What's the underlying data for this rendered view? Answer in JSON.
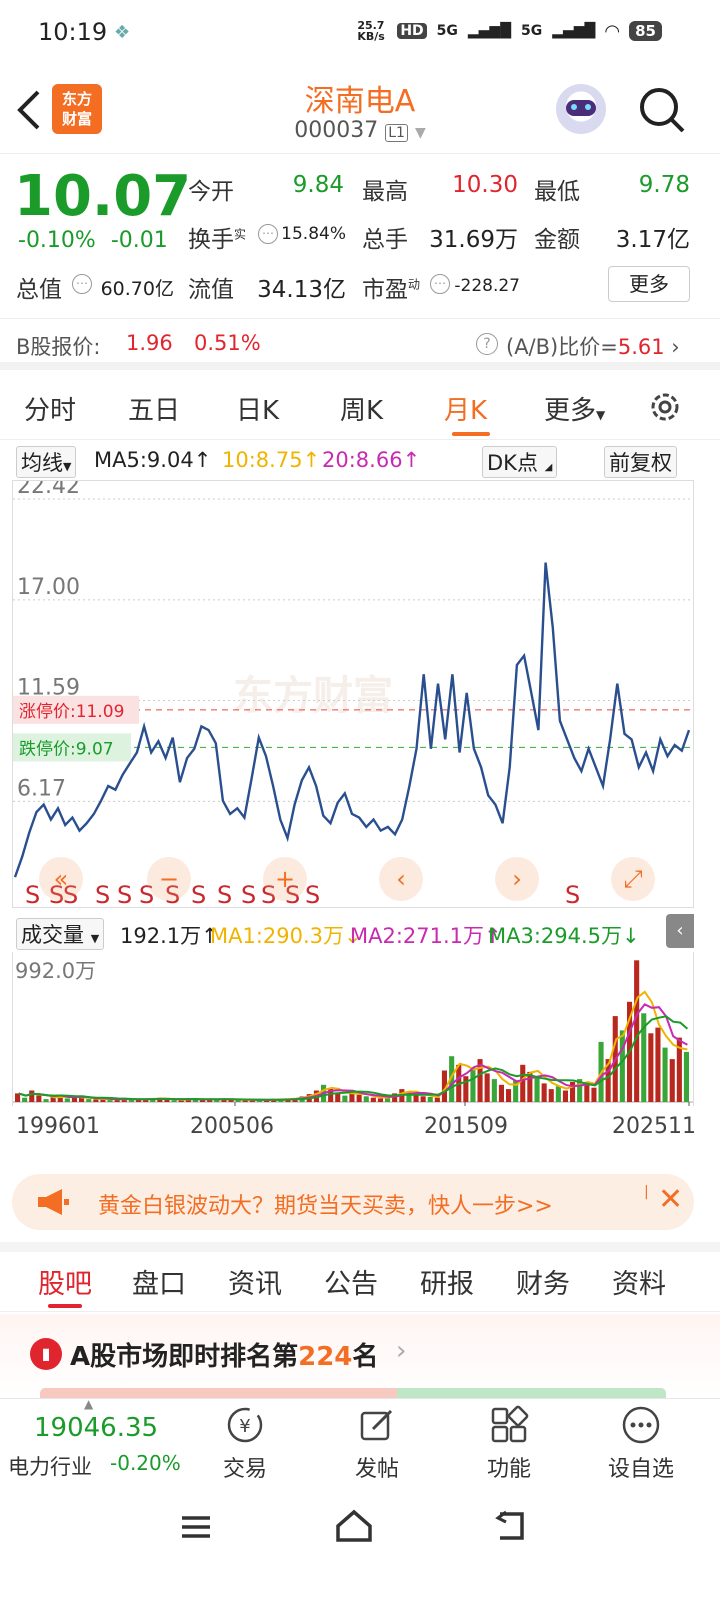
{
  "status": {
    "time": "10:19",
    "net_speed": "25.7 KB/s",
    "hd": "HD",
    "sig1": "5G",
    "sig2": "5G",
    "battery": "85"
  },
  "header": {
    "logo_line1": "东方",
    "logo_line2": "财富",
    "title": "深南电A",
    "code": "000037",
    "level": "L1"
  },
  "quote": {
    "price": "10.07",
    "change_pct": "-0.10%",
    "change": "-0.01",
    "open_label": "今开",
    "open": "9.84",
    "high_label": "最高",
    "high": "10.30",
    "low_label": "最低",
    "low": "9.78",
    "turnover_label": "换手",
    "turnover_sup": "实",
    "turnover": "15.84%",
    "volume_label": "总手",
    "volume": "31.69万",
    "amount_label": "金额",
    "amount": "3.17亿",
    "mktcap_label": "总值",
    "mktcap": "60.70亿",
    "float_label": "流值",
    "float_cap": "34.13亿",
    "pe_label": "市盈",
    "pe_sup": "动",
    "pe": "-228.27",
    "more_label": "更多"
  },
  "bshare": {
    "label": "B股报价:",
    "price": "1.96",
    "pct": "0.51%",
    "ratio_label": "(A/B)比价=",
    "ratio": "5.61"
  },
  "tabs": [
    "分时",
    "五日",
    "日K",
    "周K",
    "月K",
    "更多"
  ],
  "ma_bar": {
    "select": "均线",
    "ma5": "MA5:9.04",
    "ma10": "10:8.75",
    "ma20": "20:8.66",
    "dk": "DK点",
    "fq": "前复权"
  },
  "chart_data": {
    "type": "line",
    "title": "",
    "ylabels": [
      "22.42",
      "17.00",
      "11.59",
      "6.17"
    ],
    "ylim": [
      2.0,
      22.42
    ],
    "limit_up": {
      "label": "涨停价:11.09",
      "value": 11.09
    },
    "limit_down": {
      "label": "跌停价:9.07",
      "value": 9.07
    },
    "watermark": "东方财富",
    "sell_marks": [
      "S",
      "S",
      "S",
      "S",
      "S",
      "S",
      "S",
      "S",
      "S",
      "S",
      "S",
      "S",
      "S",
      "S"
    ],
    "series": [
      {
        "values": [
          2.1,
          3.2,
          4.5,
          5.6,
          6.0,
          5.2,
          5.8,
          4.9,
          5.3,
          4.6,
          5.0,
          5.5,
          6.2,
          7.0,
          6.8,
          7.6,
          8.2,
          8.8,
          10.2,
          8.8,
          9.4,
          8.5,
          9.6,
          7.2,
          8.5,
          9.0,
          10.2,
          10.0,
          9.3,
          6.2,
          5.5,
          5.8,
          5.3,
          7.4,
          9.6,
          8.6,
          7.0,
          5.2,
          4.2,
          6.0,
          7.3,
          8.0,
          7.0,
          5.4,
          5.0,
          6.1,
          6.6,
          5.5,
          5.3,
          4.8,
          5.2,
          4.6,
          4.8,
          4.4,
          5.2,
          7.0,
          9.0,
          13.0,
          9.0,
          12.5,
          9.5,
          13.0,
          8.8,
          12.0,
          9.0,
          8.0,
          6.5,
          6.0,
          5.0,
          8.0,
          13.5,
          14.0,
          12.0,
          10.0,
          19.0,
          15.5,
          10.5,
          9.5,
          8.5,
          7.8,
          9.0,
          8.0,
          7.0,
          9.5,
          12.5,
          9.8,
          9.5,
          8.0,
          8.8,
          7.8,
          9.5,
          8.6,
          9.2,
          8.9,
          10.0
        ]
      }
    ],
    "volume": {
      "select": "成交量",
      "value": "192.1万",
      "ma1": "MA1:290.3万",
      "ma2": "MA2:271.1万",
      "ma3": "MA3:294.5万",
      "ymax_label": "992.0万",
      "ylim": [
        0,
        992
      ],
      "bars": [
        60,
        30,
        80,
        45,
        20,
        35,
        50,
        25,
        40,
        30,
        20,
        18,
        25,
        15,
        20,
        22,
        16,
        18,
        20,
        25,
        30,
        15,
        12,
        18,
        25,
        20,
        14,
        18,
        22,
        20,
        16,
        12,
        18,
        14,
        12,
        16,
        20,
        18,
        22,
        28,
        40,
        55,
        80,
        120,
        95,
        60,
        45,
        75,
        50,
        40,
        30,
        25,
        38,
        60,
        90,
        70,
        55,
        40,
        35,
        30,
        220,
        320,
        260,
        180,
        240,
        300,
        200,
        160,
        120,
        90,
        150,
        260,
        210,
        180,
        130,
        90,
        110,
        80,
        140,
        160,
        120,
        100,
        420,
        300,
        600,
        500,
        700,
        990,
        620,
        480,
        520,
        380,
        300,
        450,
        350
      ],
      "x_labels": [
        "199601",
        "200506",
        "201509",
        "202511"
      ]
    }
  },
  "ad": {
    "text": "黄金白银波动大？期货当天买卖，快人一步>>"
  },
  "bottom_tabs": [
    "股吧",
    "盘口",
    "资讯",
    "公告",
    "研报",
    "财务",
    "资料"
  ],
  "rank": {
    "prefix": "A股市场即时排名第",
    "num": "224",
    "suffix": "名"
  },
  "footer": {
    "index": "19046.35",
    "sector": "电力行业",
    "sector_pct": "-0.20%",
    "trade": "交易",
    "post": "发帖",
    "func": "功能",
    "watch": "设自选"
  },
  "colors": {
    "accent": "#f36d22",
    "up": "#e0252e",
    "down": "#1a9b2a",
    "line": "#2a4f8f"
  }
}
